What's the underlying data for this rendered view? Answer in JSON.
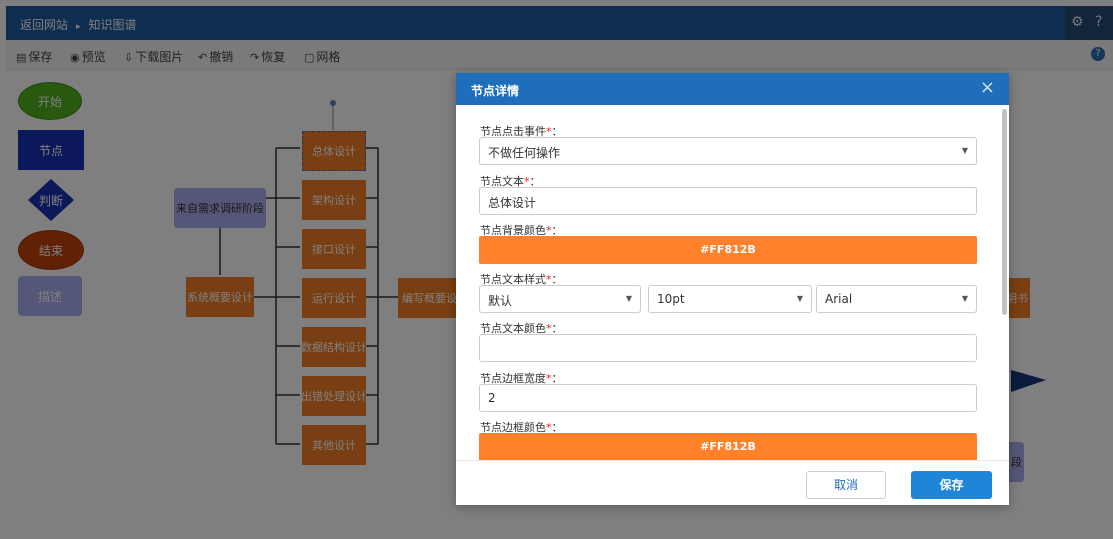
{
  "header": {
    "back_link": "返回网站",
    "page_name": "知识图谱",
    "settings_icon": "gear-icon",
    "help_icon": "question-icon"
  },
  "toolbar": {
    "save": "保存",
    "preview": "预览",
    "download": "下载图片",
    "undo": "撤销",
    "redo": "恢复",
    "grid": "网格"
  },
  "palette": {
    "start": "开始",
    "node": "节点",
    "judge": "判断",
    "end": "结束",
    "desc": "描述"
  },
  "flow": {
    "source": "来自需求调研阶段",
    "overview": "系统概要设计",
    "overall": "总体设计",
    "arch": "架构设计",
    "iface": "接口设计",
    "runtime": "运行设计",
    "datastruct": "数据结构设计",
    "error": "出错处理设计",
    "other": "其他设计",
    "write": "编写概要设",
    "right_partial": "明书",
    "bottom_partial": "段"
  },
  "modal": {
    "title": "节点详情",
    "event_label": "节点点击事件",
    "event_value": "不做任何操作",
    "text_label": "节点文本",
    "text_value": "总体设计",
    "bg_label": "节点背景颜色",
    "bg_value": "#FF812B",
    "style_label": "节点文本样式",
    "style_weight": "默认",
    "style_size": "10pt",
    "style_font": "Arial",
    "text_color_label": "节点文本颜色",
    "text_color_value": "",
    "border_width_label": "节点边框宽度",
    "border_width_value": "2",
    "border_color_label": "节点边框颜色",
    "border_color_value": "#FF812B",
    "required_mark": "*",
    "colon": "：",
    "cancel": "取消",
    "save": "保存"
  },
  "colors": {
    "header_blue": "#1e5aa2",
    "modal_header": "#1e6ebc",
    "node_orange": "#f37d24",
    "color_swatch": "#ff812b",
    "primary_button": "#1e86d8"
  }
}
